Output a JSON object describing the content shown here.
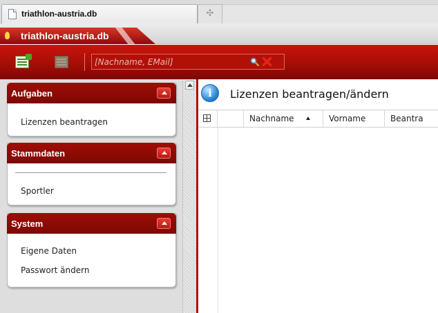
{
  "browser": {
    "tab_title": "triathlon-austria.db",
    "new_tab_symbol": "✣"
  },
  "app": {
    "title": "triathlon-austria.db"
  },
  "toolbar": {
    "search_placeholder": "[Nachname, EMail]",
    "search_value": "",
    "icons": [
      "new-record-icon",
      "edit-record-icon",
      "search-icon",
      "clear-icon"
    ]
  },
  "sidebar": {
    "panels": [
      {
        "title": "Aufgaben",
        "items": [
          "Lizenzen beantragen"
        ]
      },
      {
        "title": "Stammdaten",
        "items": [
          "Sportler"
        ]
      },
      {
        "title": "System",
        "items": [
          "Eigene Daten",
          "Passwort ändern"
        ]
      }
    ]
  },
  "main": {
    "title": "Lizenzen beantragen/ändern",
    "columns": [
      "Nachname",
      "Vorname",
      "Beantra"
    ],
    "sorted_column": "Nachname",
    "sort_direction": "ascending"
  },
  "colors": {
    "accent_red": "#b00c06",
    "header_red": "#8e0a05",
    "sidebar_bg": "#dedede"
  }
}
